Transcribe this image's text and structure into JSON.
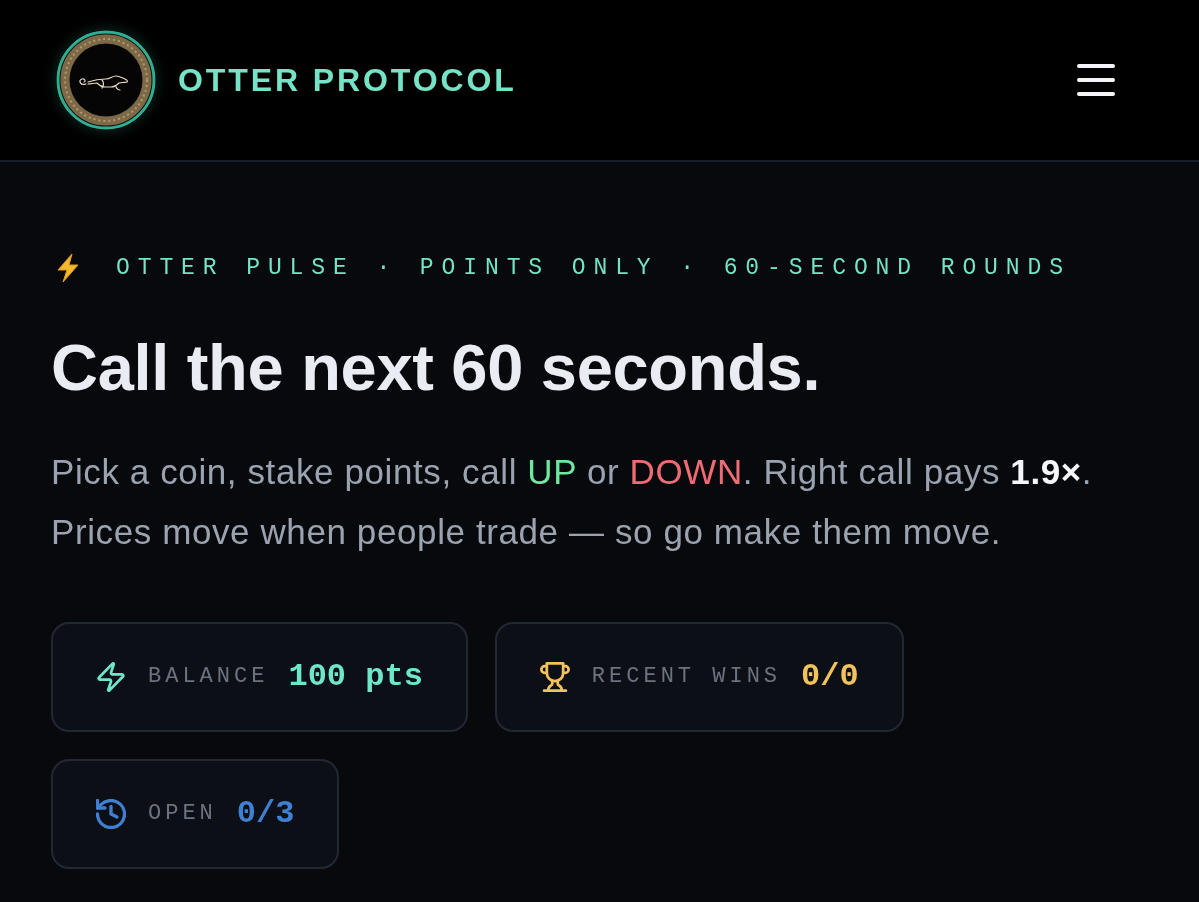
{
  "header": {
    "brand": "OTTER PROTOCOL"
  },
  "kicker": "OTTER PULSE · POINTS ONLY · 60-SECOND ROUNDS",
  "title": "Call the next 60 seconds.",
  "intro": [
    {
      "kind": "plain",
      "text": "Pick a coin, stake points, call "
    },
    {
      "kind": "up",
      "text": "UP"
    },
    {
      "kind": "plain",
      "text": " or "
    },
    {
      "kind": "down",
      "text": "DOWN"
    },
    {
      "kind": "plain",
      "text": ". Right call pays "
    },
    {
      "kind": "strong",
      "text": "1.9×"
    },
    {
      "kind": "plain",
      "text": ". Prices move when people trade — so go make them move."
    }
  ],
  "stats": [
    {
      "kind": "balance",
      "label": "BALANCE",
      "value": "100 pts",
      "color": "#6ee7c8"
    },
    {
      "kind": "wins",
      "label": "RECENT WINS",
      "value": "0/0",
      "color": "#f4c25c"
    },
    {
      "kind": "open",
      "label": "OPEN",
      "value": "0/3",
      "color": "#3f7fd4"
    }
  ]
}
